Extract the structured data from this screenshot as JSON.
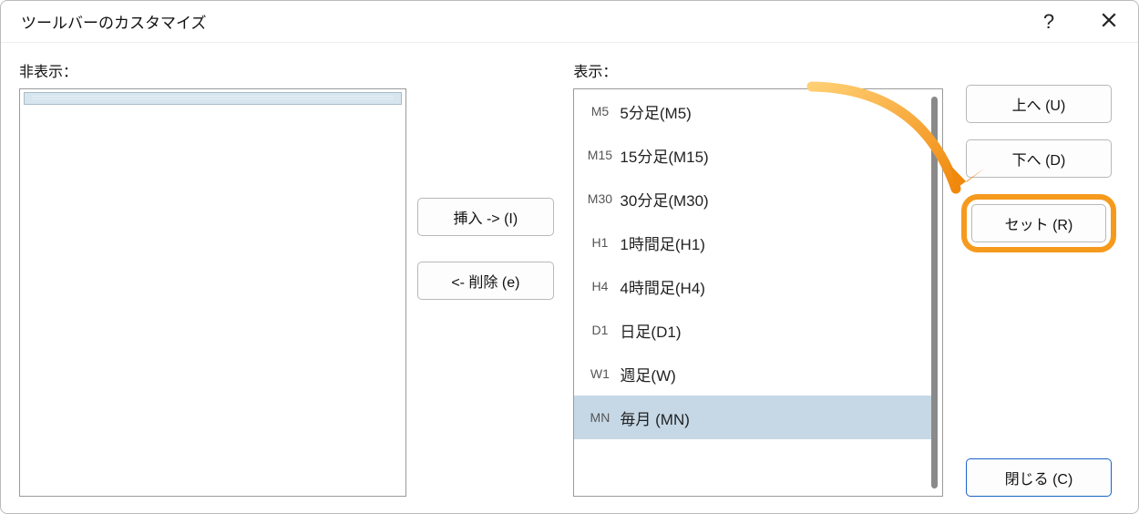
{
  "dialog": {
    "title": "ツールバーのカスタマイズ"
  },
  "labels": {
    "hidden": "非表示：",
    "shown": "表示："
  },
  "buttons": {
    "insert": "挿入 -> (I)",
    "remove": "<- 削除 (e)",
    "up": "上へ (U)",
    "down": "下へ (D)",
    "reset": "セット (R)",
    "close": "閉じる (C)"
  },
  "shown_items": [
    {
      "icon": "M5",
      "label": "5分足(M5)",
      "selected": false
    },
    {
      "icon": "M15",
      "label": "15分足(M15)",
      "selected": false
    },
    {
      "icon": "M30",
      "label": "30分足(M30)",
      "selected": false
    },
    {
      "icon": "H1",
      "label": "1時間足(H1)",
      "selected": false
    },
    {
      "icon": "H4",
      "label": "4時間足(H4)",
      "selected": false
    },
    {
      "icon": "D1",
      "label": "日足(D1)",
      "selected": false
    },
    {
      "icon": "W1",
      "label": "週足(W)",
      "selected": false
    },
    {
      "icon": "MN",
      "label": "毎月 (MN)",
      "selected": true
    }
  ]
}
